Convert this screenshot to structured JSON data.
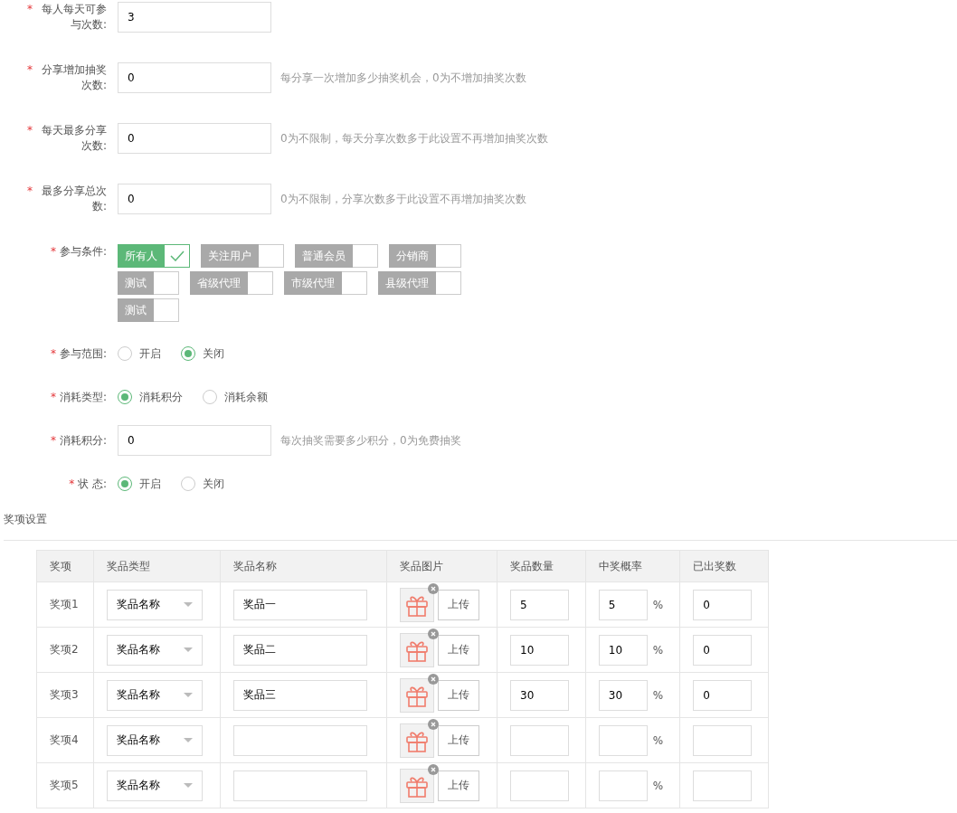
{
  "form": {
    "fields": [
      {
        "kind": "input",
        "required_mark": "*",
        "label": "每人每天可参与次数:",
        "value": "3"
      },
      {
        "kind": "input",
        "required_mark": "*",
        "label": "分享增加抽奖次数:",
        "value": "0",
        "hint": "每分享一次增加多少抽奖机会，0为不增加抽奖次数"
      },
      {
        "kind": "input",
        "required_mark": "*",
        "label": "每天最多分享次数:",
        "value": "0",
        "hint": "0为不限制，每天分享次数多于此设置不再增加抽奖次数"
      },
      {
        "kind": "input",
        "required_mark": "*",
        "label": "最多分享总次数:",
        "value": "0",
        "hint": "0为不限制，分享次数多于此设置不再增加抽奖次数"
      },
      {
        "kind": "tags",
        "required_mark": "*",
        "label": "参与条件:",
        "options": [
          {
            "label": "所有人",
            "checked": true
          },
          {
            "label": "关注用户",
            "checked": false
          },
          {
            "label": "普通会员",
            "checked": false
          },
          {
            "label": "分销商",
            "checked": false
          },
          {
            "label": "测试",
            "checked": false
          },
          {
            "label": "省级代理",
            "checked": false
          },
          {
            "label": "市级代理",
            "checked": false
          },
          {
            "label": "县级代理",
            "checked": false
          },
          {
            "label": "测试",
            "checked": false
          }
        ]
      },
      {
        "kind": "radio",
        "required_mark": "*",
        "label": "参与范围:",
        "options": [
          {
            "label": "开启",
            "selected": false
          },
          {
            "label": "关闭",
            "selected": true
          }
        ]
      },
      {
        "kind": "radio",
        "required_mark": "*",
        "label": "消耗类型:",
        "options": [
          {
            "label": "消耗积分",
            "selected": true
          },
          {
            "label": "消耗余额",
            "selected": false
          }
        ]
      },
      {
        "kind": "input",
        "required_mark": "*",
        "label": "消耗积分:",
        "value": "0",
        "hint": "每次抽奖需要多少积分，0为免费抽奖"
      },
      {
        "kind": "radio",
        "required_mark": "*",
        "label": "状 态:",
        "options": [
          {
            "label": "开启",
            "selected": true
          },
          {
            "label": "关闭",
            "selected": false
          }
        ]
      }
    ]
  },
  "prizes": {
    "title": "奖项设置",
    "columns": [
      "奖项",
      "奖品类型",
      "奖品名称",
      "奖品图片",
      "奖品数量",
      "中奖概率",
      "已出奖数"
    ],
    "rows": [
      {
        "item": "奖项1",
        "type": "奖品名称",
        "name": "奖品一",
        "upload": "上传",
        "quantity": "5",
        "rate": "5",
        "percent": "%",
        "issued": "0"
      },
      {
        "item": "奖项2",
        "type": "奖品名称",
        "name": "奖品二",
        "upload": "上传",
        "quantity": "10",
        "rate": "10",
        "percent": "%",
        "issued": "0"
      },
      {
        "item": "奖项3",
        "type": "奖品名称",
        "name": "奖品三",
        "upload": "上传",
        "quantity": "30",
        "rate": "30",
        "percent": "%",
        "issued": "0"
      },
      {
        "item": "奖项4",
        "type": "奖品名称",
        "upload": "上传",
        "percent": "%"
      },
      {
        "item": "奖项5",
        "type": "奖品名称",
        "upload": "上传",
        "percent": "%"
      }
    ]
  }
}
